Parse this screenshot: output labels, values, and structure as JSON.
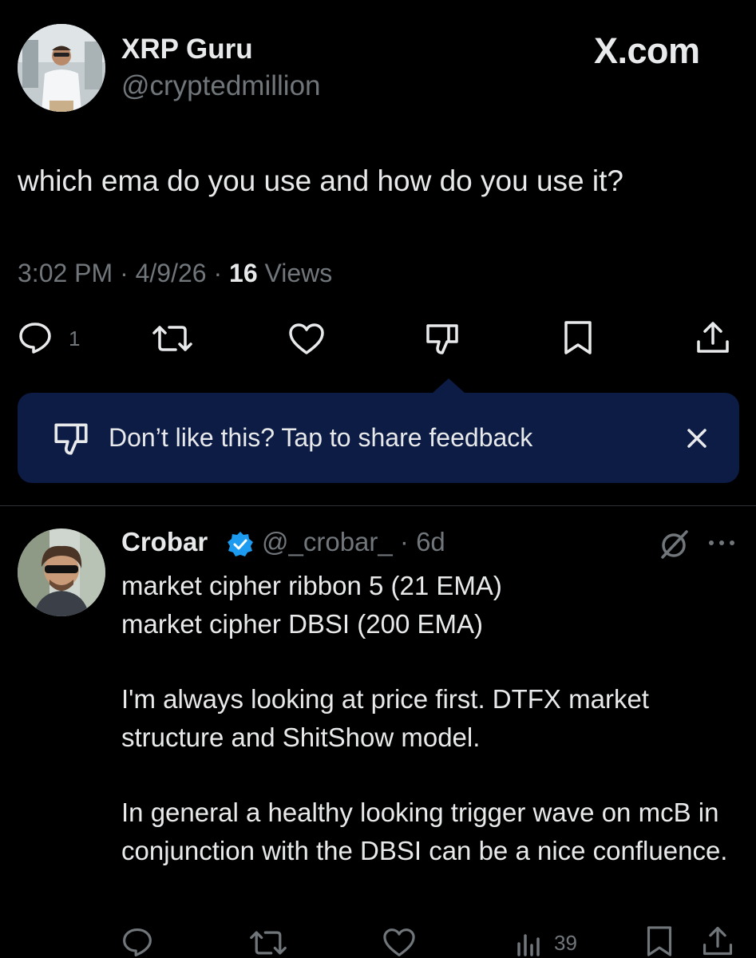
{
  "brand": "X.com",
  "post": {
    "author_name": "XRP Guru",
    "author_handle": "@cryptedmillion",
    "text": "which ema do you use and how do you use it?",
    "time": "3:02 PM",
    "sep1": " · ",
    "date": "4/9/26",
    "sep2": " · ",
    "views_count": "16",
    "views_label": " Views",
    "reply_count": "1",
    "action_icons": [
      "reply-icon",
      "repost-icon",
      "like-icon",
      "dislike-icon",
      "bookmark-icon",
      "share-icon"
    ]
  },
  "feedback_banner": {
    "text": "Don’t like this? Tap to share feedback",
    "background": "#0d1c45"
  },
  "reply": {
    "author_name": "Crobar",
    "verified": true,
    "handle_and_time": "@_crobar_ · 6d",
    "lines": [
      "market cipher ribbon 5 (21 EMA)",
      "market cipher DBSI (200 EMA)",
      "I'm always looking at price first. DTFX market structure and ShitShow model.",
      "In general a healthy looking trigger wave on mcB in conjunction with the DBSI can be a nice confluence."
    ],
    "views_count": "39"
  },
  "colors": {
    "background": "#000000",
    "text_primary": "#e7e9ea",
    "text_secondary": "#71767b",
    "verified_badge": "#1d9bf0"
  }
}
